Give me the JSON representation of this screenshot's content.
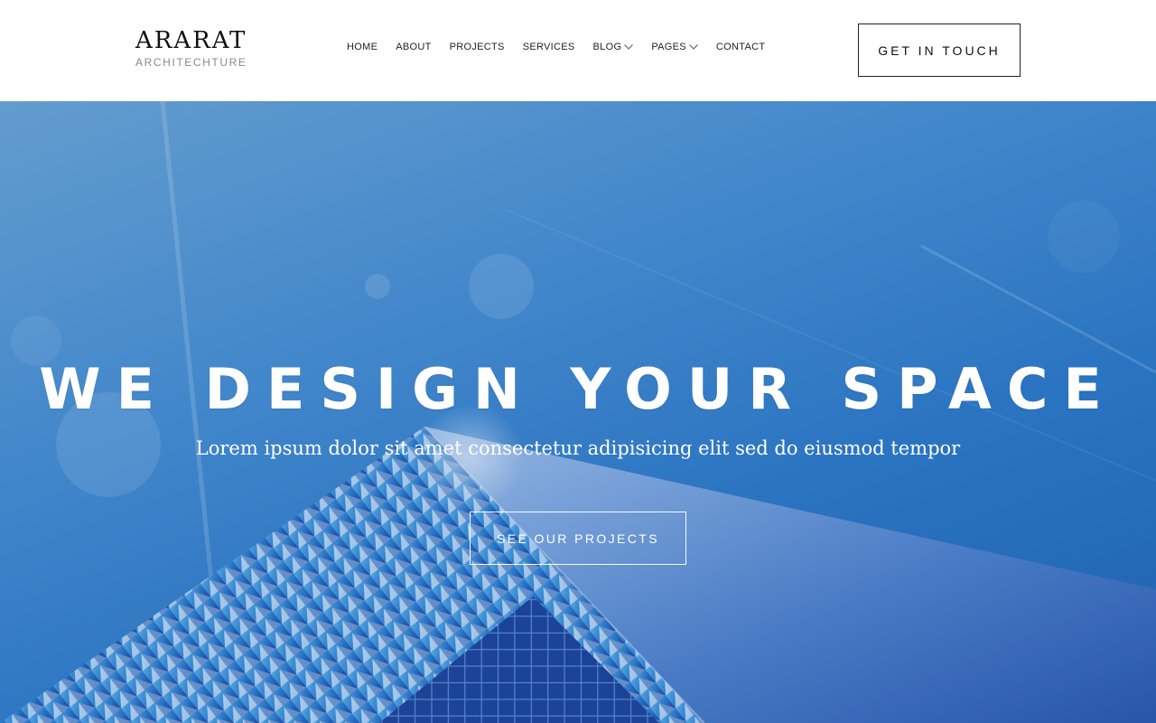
{
  "brand": {
    "name": "ARARAT",
    "tagline": "ARCHITECHTURE"
  },
  "nav": {
    "items": [
      {
        "label": "HOME"
      },
      {
        "label": "ABOUT"
      },
      {
        "label": "PROJECTS"
      },
      {
        "label": "SERVICES"
      },
      {
        "label": "BLOG"
      },
      {
        "label": "PAGES"
      },
      {
        "label": "CONTACT"
      }
    ],
    "dropdown_icon": "chevron-down-icon"
  },
  "header": {
    "cta_label": "GET IN TOUCH"
  },
  "hero": {
    "title": "WE DESIGN YOUR SPACE",
    "subtitle": "Lorem ipsum dolor sit amet consectetur adipisicing elit sed do eiusmod tempor",
    "button_label": "SEE OUR PROJECTS",
    "sky_color": "#3f87cc",
    "building_color": "#1c4ea8"
  }
}
